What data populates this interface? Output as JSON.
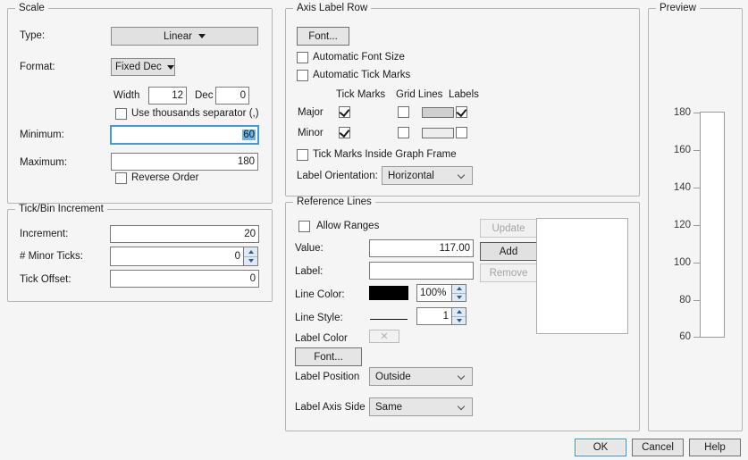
{
  "scale": {
    "legend": "Scale",
    "type_label": "Type:",
    "type_value": "Linear",
    "format_label": "Format:",
    "format_value": "Fixed Dec",
    "width_label": "Width",
    "width_value": "12",
    "dec_label": "Dec",
    "dec_value": "0",
    "thousands_label": "Use thousands separator (,)",
    "thousands_checked": false,
    "minimum_label": "Minimum:",
    "minimum_value": "60",
    "maximum_label": "Maximum:",
    "maximum_value": "180",
    "reverse_label": "Reverse Order",
    "reverse_checked": false
  },
  "tickbin": {
    "legend": "Tick/Bin Increment",
    "increment_label": "Increment:",
    "increment_value": "20",
    "minor_ticks_label": "# Minor Ticks:",
    "minor_ticks_value": "0",
    "tick_offset_label": "Tick Offset:",
    "tick_offset_value": "0"
  },
  "axis_label_row": {
    "legend": "Axis Label Row",
    "font_button": "Font...",
    "auto_font_size_label": "Automatic Font Size",
    "auto_font_size_checked": false,
    "auto_tick_marks_label": "Automatic Tick Marks",
    "auto_tick_marks_checked": false,
    "col_tick_marks": "Tick Marks",
    "col_grid_lines": "Grid Lines",
    "col_labels": "Labels",
    "row_major": "Major",
    "row_minor": "Minor",
    "major_tick_checked": true,
    "major_grid_checked": false,
    "major_grid_color": "#cfcfcf",
    "major_labels_checked": true,
    "minor_tick_checked": true,
    "minor_grid_checked": false,
    "minor_grid_color": "#ededed",
    "minor_labels_checked": false,
    "ticks_inside_label": "Tick Marks Inside Graph Frame",
    "ticks_inside_checked": false,
    "label_orientation_label": "Label Orientation:",
    "label_orientation_value": "Horizontal"
  },
  "reference_lines": {
    "legend": "Reference Lines",
    "allow_ranges_label": "Allow Ranges",
    "allow_ranges_checked": false,
    "value_label": "Value:",
    "value_value": "117.00",
    "label_label": "Label:",
    "label_value": "",
    "line_color_label": "Line Color:",
    "line_color": "#000000",
    "opacity_value": "100%",
    "line_style_label": "Line Style:",
    "line_width_value": "1",
    "label_color_label": "Label Color",
    "label_color_swatch": "✕",
    "font_button": "Font...",
    "label_position_label": "Label Position",
    "label_position_value": "Outside",
    "label_axis_side_label": "Label Axis Side",
    "label_axis_side_value": "Same",
    "update_button": "Update",
    "add_button": "Add",
    "remove_button": "Remove",
    "list_items": []
  },
  "preview": {
    "legend": "Preview",
    "axis_min": 60,
    "axis_max": 180,
    "tick_labels": [
      "180",
      "160",
      "140",
      "120",
      "100",
      "80",
      "60"
    ]
  },
  "footer": {
    "ok": "OK",
    "cancel": "Cancel",
    "help": "Help"
  }
}
